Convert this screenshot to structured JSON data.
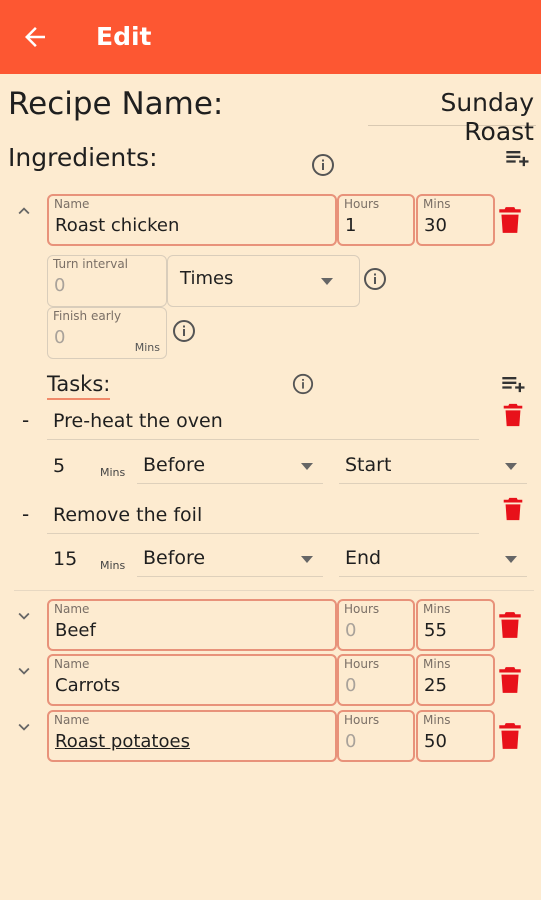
{
  "app_bar": {
    "title": "Edit"
  },
  "recipe": {
    "name_label": "Recipe Name:",
    "name_value": "Sunday Roast"
  },
  "ingredients_header": {
    "label": "Ingredients:"
  },
  "labels": {
    "name": "Name",
    "hours": "Hours",
    "mins": "Mins",
    "turn_interval": "Turn interval",
    "finish_early": "Finish early",
    "mins_unit": "Mins"
  },
  "ingredients": [
    {
      "name": "Roast chicken",
      "hours": "1",
      "mins": "30"
    },
    {
      "name": "Beef",
      "hours": "0",
      "mins": "55"
    },
    {
      "name": "Carrots",
      "hours": "0",
      "mins": "25"
    },
    {
      "name": "Roast potatoes",
      "hours": "0",
      "mins": "50"
    }
  ],
  "expanded": {
    "turn_interval_value": "0",
    "times_option": "Times",
    "finish_early_value": "0",
    "tasks_label": "Tasks:",
    "tasks": [
      {
        "dash": "-",
        "text": "Pre-heat the oven",
        "mins": "5",
        "unit": "Mins",
        "relation": "Before",
        "anchor": "Start"
      },
      {
        "dash": "-",
        "text": "Remove the foil",
        "mins": "15",
        "unit": "Mins",
        "relation": "Before",
        "anchor": "End"
      }
    ]
  },
  "colors": {
    "app_bar": "#fd5732",
    "background": "#fdebd0",
    "field_border": "#e8927a",
    "delete_icon": "#e8111a"
  }
}
